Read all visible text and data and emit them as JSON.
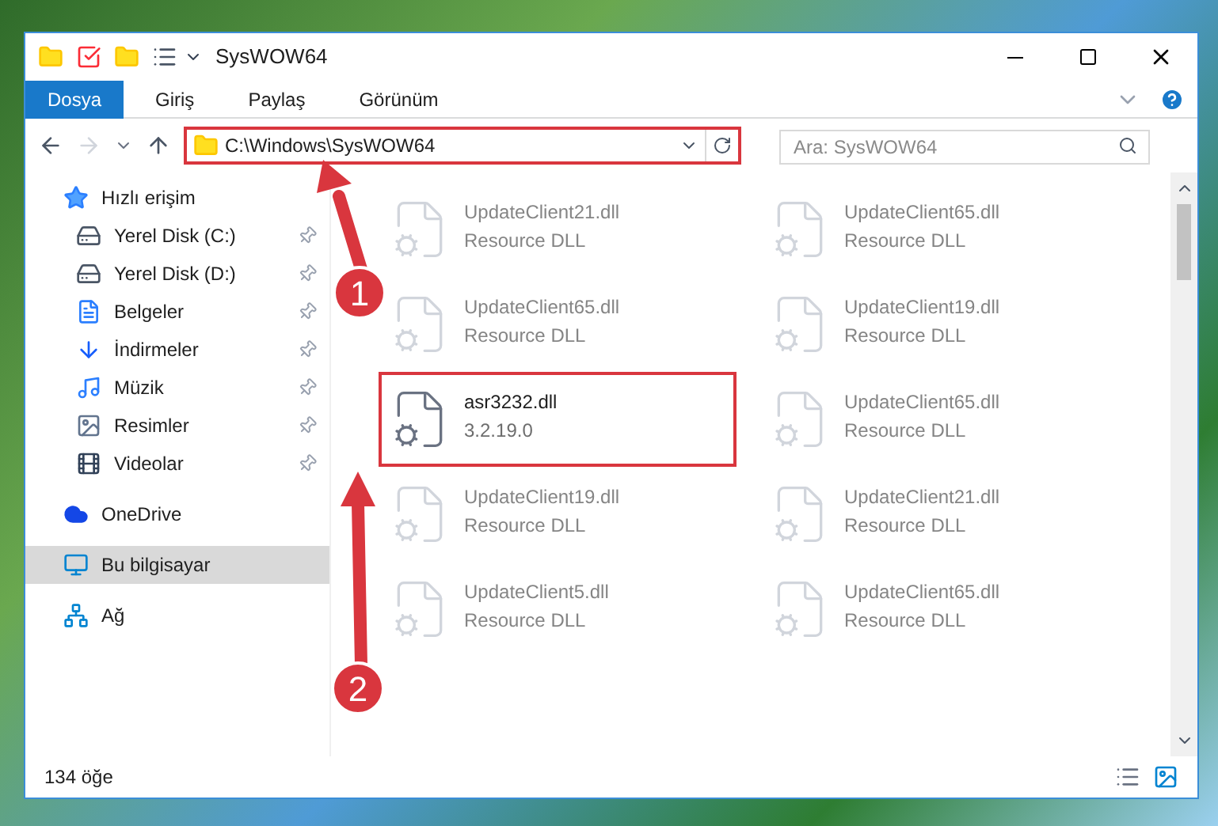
{
  "window": {
    "title": "SysWOW64"
  },
  "ribbon_tabs": [
    {
      "label": "Dosya",
      "selected": true
    },
    {
      "label": "Giriş",
      "selected": false
    },
    {
      "label": "Paylaş",
      "selected": false
    },
    {
      "label": "Görünüm",
      "selected": false
    }
  ],
  "address_bar": {
    "path": "C:\\Windows\\SysWOW64",
    "highlighted": true
  },
  "search": {
    "placeholder": "Ara: SysWOW64"
  },
  "sidebar": {
    "items": [
      {
        "label": "Hızlı erişim",
        "selected": false,
        "children": [
          {
            "label": "Yerel Disk (C:)",
            "selected": false,
            "pinned": true
          },
          {
            "label": "Yerel Disk (D:)",
            "selected": false,
            "pinned": true
          },
          {
            "label": "Belgeler",
            "selected": false,
            "pinned": true
          },
          {
            "label": "İndirmeler",
            "selected": false,
            "pinned": true
          },
          {
            "label": "Müzik",
            "selected": false,
            "pinned": true
          },
          {
            "label": "Resimler",
            "selected": false,
            "pinned": true
          },
          {
            "label": "Videolar",
            "selected": false,
            "pinned": true
          }
        ]
      },
      {
        "label": "OneDrive",
        "selected": false
      },
      {
        "label": "Bu bilgisayar",
        "selected": true
      },
      {
        "label": "Ağ",
        "selected": false
      }
    ]
  },
  "files": [
    {
      "name": "UpdateClient21.dll",
      "detail": "Resource DLL",
      "highlighted": false
    },
    {
      "name": "UpdateClient65.dll",
      "detail": "Resource DLL",
      "highlighted": false
    },
    {
      "name": "UpdateClient65.dll",
      "detail": "Resource DLL",
      "highlighted": false
    },
    {
      "name": "UpdateClient19.dll",
      "detail": "Resource DLL",
      "highlighted": false
    },
    {
      "name": "asr3232.dll",
      "detail": "3.2.19.0",
      "highlighted": true
    },
    {
      "name": "UpdateClient65.dll",
      "detail": "Resource DLL",
      "highlighted": false
    },
    {
      "name": "UpdateClient19.dll",
      "detail": "Resource DLL",
      "highlighted": false
    },
    {
      "name": "UpdateClient21.dll",
      "detail": "Resource DLL",
      "highlighted": false
    },
    {
      "name": "UpdateClient5.dll",
      "detail": "Resource DLL",
      "highlighted": false
    },
    {
      "name": "UpdateClient65.dll",
      "detail": "Resource DLL",
      "highlighted": false
    }
  ],
  "annotations": [
    {
      "label": "1"
    },
    {
      "label": "2"
    }
  ],
  "status_bar": {
    "item_count": "134 öğe"
  }
}
